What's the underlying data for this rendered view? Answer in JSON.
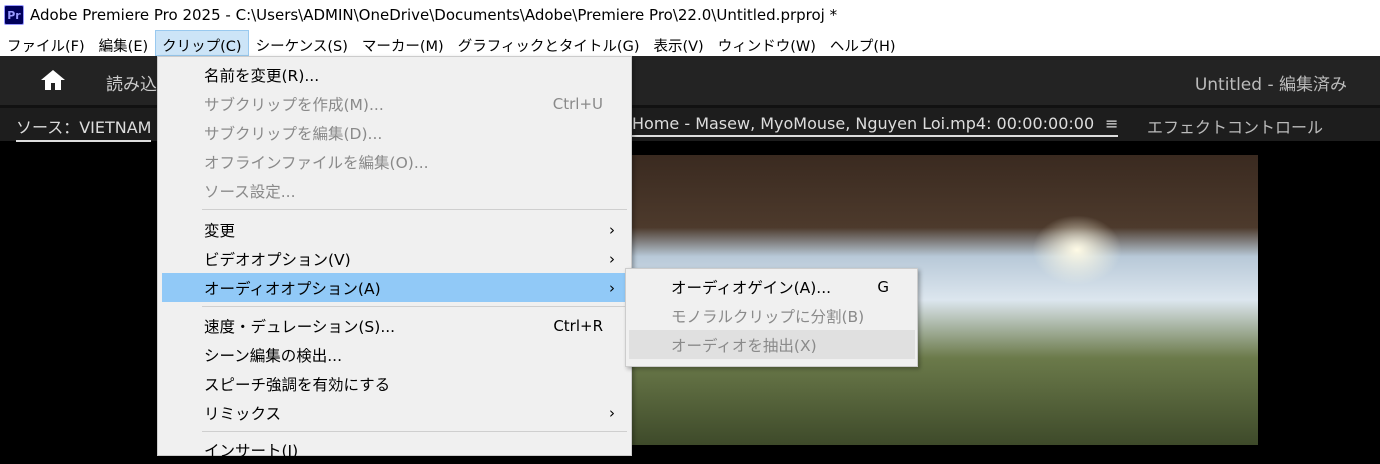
{
  "window": {
    "title": "Adobe Premiere Pro 2025 - C:\\Users\\ADMIN\\OneDrive\\Documents\\Adobe\\Premiere Pro\\22.0\\Untitled.prproj *",
    "logo": "Pr"
  },
  "menubar": [
    "ファイル(F)",
    "編集(E)",
    "クリップ(C)",
    "シーケンス(S)",
    "マーカー(M)",
    "グラフィックとタイトル(G)",
    "表示(V)",
    "ウィンドウ(W)",
    "ヘルプ(H)"
  ],
  "header": {
    "import": "読み込",
    "project": "Untitled - 編集済み"
  },
  "panel": {
    "source": "ソース：VIETNAM",
    "source_clip": "Home - Masew, MyoMouse, Nguyen Loi.mp4: 00:00:00:00",
    "menu_icon": "≡",
    "effects": "エフェクトコントロール"
  },
  "clip_menu": [
    {
      "label": "名前を変更(R)...",
      "shortcut": "",
      "disabled": false
    },
    {
      "label": "サブクリップを作成(M)...",
      "shortcut": "Ctrl+U",
      "disabled": true
    },
    {
      "label": "サブクリップを編集(D)...",
      "shortcut": "",
      "disabled": true
    },
    {
      "label": "オフラインファイルを編集(O)...",
      "shortcut": "",
      "disabled": true
    },
    {
      "label": "ソース設定...",
      "shortcut": "",
      "disabled": true
    },
    {
      "label": "変更",
      "submenu": true
    },
    {
      "label": "ビデオオプション(V)",
      "submenu": true
    },
    {
      "label": "オーディオオプション(A)",
      "submenu": true,
      "highlighted": true
    },
    {
      "label": "速度・デュレーション(S)...",
      "shortcut": "Ctrl+R"
    },
    {
      "label": "シーン編集の検出..."
    },
    {
      "label": "スピーチ強調を有効にする"
    },
    {
      "label": "リミックス",
      "submenu": true
    },
    {
      "label": "インサート(I)"
    }
  ],
  "audio_submenu": [
    {
      "label": "オーディオゲイン(A)...",
      "shortcut": "G",
      "disabled": false
    },
    {
      "label": "モノラルクリップに分割(B)",
      "disabled": true
    },
    {
      "label": "オーディオを抽出(X)",
      "disabled": true
    }
  ],
  "colors": {
    "highlight": "#91c9f7",
    "menu_bg": "#f0f0f0",
    "dark": "#232323"
  }
}
